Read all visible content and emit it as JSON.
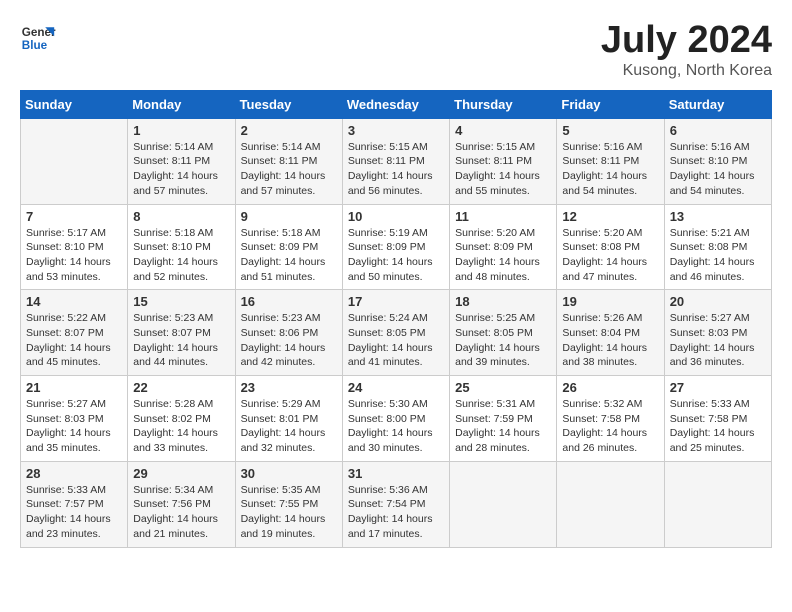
{
  "header": {
    "logo_line1": "General",
    "logo_line2": "Blue",
    "month_year": "July 2024",
    "location": "Kusong, North Korea"
  },
  "weekdays": [
    "Sunday",
    "Monday",
    "Tuesday",
    "Wednesday",
    "Thursday",
    "Friday",
    "Saturday"
  ],
  "weeks": [
    [
      {
        "day": "",
        "info": ""
      },
      {
        "day": "1",
        "info": "Sunrise: 5:14 AM\nSunset: 8:11 PM\nDaylight: 14 hours\nand 57 minutes."
      },
      {
        "day": "2",
        "info": "Sunrise: 5:14 AM\nSunset: 8:11 PM\nDaylight: 14 hours\nand 57 minutes."
      },
      {
        "day": "3",
        "info": "Sunrise: 5:15 AM\nSunset: 8:11 PM\nDaylight: 14 hours\nand 56 minutes."
      },
      {
        "day": "4",
        "info": "Sunrise: 5:15 AM\nSunset: 8:11 PM\nDaylight: 14 hours\nand 55 minutes."
      },
      {
        "day": "5",
        "info": "Sunrise: 5:16 AM\nSunset: 8:11 PM\nDaylight: 14 hours\nand 54 minutes."
      },
      {
        "day": "6",
        "info": "Sunrise: 5:16 AM\nSunset: 8:10 PM\nDaylight: 14 hours\nand 54 minutes."
      }
    ],
    [
      {
        "day": "7",
        "info": "Sunrise: 5:17 AM\nSunset: 8:10 PM\nDaylight: 14 hours\nand 53 minutes."
      },
      {
        "day": "8",
        "info": "Sunrise: 5:18 AM\nSunset: 8:10 PM\nDaylight: 14 hours\nand 52 minutes."
      },
      {
        "day": "9",
        "info": "Sunrise: 5:18 AM\nSunset: 8:09 PM\nDaylight: 14 hours\nand 51 minutes."
      },
      {
        "day": "10",
        "info": "Sunrise: 5:19 AM\nSunset: 8:09 PM\nDaylight: 14 hours\nand 50 minutes."
      },
      {
        "day": "11",
        "info": "Sunrise: 5:20 AM\nSunset: 8:09 PM\nDaylight: 14 hours\nand 48 minutes."
      },
      {
        "day": "12",
        "info": "Sunrise: 5:20 AM\nSunset: 8:08 PM\nDaylight: 14 hours\nand 47 minutes."
      },
      {
        "day": "13",
        "info": "Sunrise: 5:21 AM\nSunset: 8:08 PM\nDaylight: 14 hours\nand 46 minutes."
      }
    ],
    [
      {
        "day": "14",
        "info": "Sunrise: 5:22 AM\nSunset: 8:07 PM\nDaylight: 14 hours\nand 45 minutes."
      },
      {
        "day": "15",
        "info": "Sunrise: 5:23 AM\nSunset: 8:07 PM\nDaylight: 14 hours\nand 44 minutes."
      },
      {
        "day": "16",
        "info": "Sunrise: 5:23 AM\nSunset: 8:06 PM\nDaylight: 14 hours\nand 42 minutes."
      },
      {
        "day": "17",
        "info": "Sunrise: 5:24 AM\nSunset: 8:05 PM\nDaylight: 14 hours\nand 41 minutes."
      },
      {
        "day": "18",
        "info": "Sunrise: 5:25 AM\nSunset: 8:05 PM\nDaylight: 14 hours\nand 39 minutes."
      },
      {
        "day": "19",
        "info": "Sunrise: 5:26 AM\nSunset: 8:04 PM\nDaylight: 14 hours\nand 38 minutes."
      },
      {
        "day": "20",
        "info": "Sunrise: 5:27 AM\nSunset: 8:03 PM\nDaylight: 14 hours\nand 36 minutes."
      }
    ],
    [
      {
        "day": "21",
        "info": "Sunrise: 5:27 AM\nSunset: 8:03 PM\nDaylight: 14 hours\nand 35 minutes."
      },
      {
        "day": "22",
        "info": "Sunrise: 5:28 AM\nSunset: 8:02 PM\nDaylight: 14 hours\nand 33 minutes."
      },
      {
        "day": "23",
        "info": "Sunrise: 5:29 AM\nSunset: 8:01 PM\nDaylight: 14 hours\nand 32 minutes."
      },
      {
        "day": "24",
        "info": "Sunrise: 5:30 AM\nSunset: 8:00 PM\nDaylight: 14 hours\nand 30 minutes."
      },
      {
        "day": "25",
        "info": "Sunrise: 5:31 AM\nSunset: 7:59 PM\nDaylight: 14 hours\nand 28 minutes."
      },
      {
        "day": "26",
        "info": "Sunrise: 5:32 AM\nSunset: 7:58 PM\nDaylight: 14 hours\nand 26 minutes."
      },
      {
        "day": "27",
        "info": "Sunrise: 5:33 AM\nSunset: 7:58 PM\nDaylight: 14 hours\nand 25 minutes."
      }
    ],
    [
      {
        "day": "28",
        "info": "Sunrise: 5:33 AM\nSunset: 7:57 PM\nDaylight: 14 hours\nand 23 minutes."
      },
      {
        "day": "29",
        "info": "Sunrise: 5:34 AM\nSunset: 7:56 PM\nDaylight: 14 hours\nand 21 minutes."
      },
      {
        "day": "30",
        "info": "Sunrise: 5:35 AM\nSunset: 7:55 PM\nDaylight: 14 hours\nand 19 minutes."
      },
      {
        "day": "31",
        "info": "Sunrise: 5:36 AM\nSunset: 7:54 PM\nDaylight: 14 hours\nand 17 minutes."
      },
      {
        "day": "",
        "info": ""
      },
      {
        "day": "",
        "info": ""
      },
      {
        "day": "",
        "info": ""
      }
    ]
  ]
}
